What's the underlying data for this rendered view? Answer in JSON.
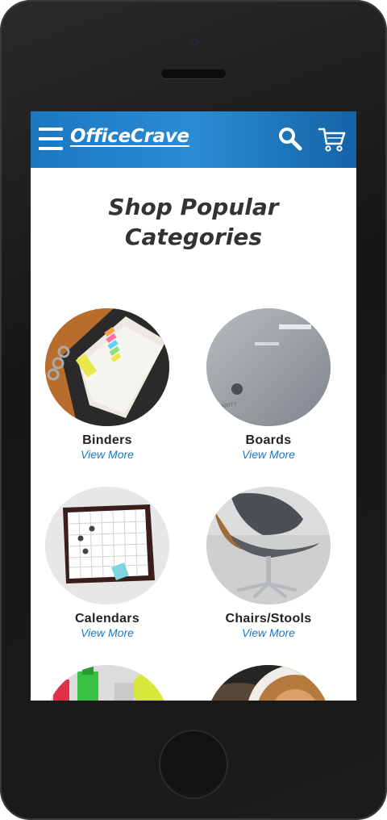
{
  "app": {
    "brand": "OfficeCrave"
  },
  "header": {
    "menu_icon": "hamburger-icon",
    "search_icon": "search-icon",
    "cart_icon": "cart-icon"
  },
  "main": {
    "title_line1": "Shop Popular",
    "title_line2": "Categories",
    "categories": [
      {
        "label": "Binders",
        "link": "View More"
      },
      {
        "label": "Boards",
        "link": "View More"
      },
      {
        "label": "Calendars",
        "link": "View More"
      },
      {
        "label": "Chairs/Stools",
        "link": "View More"
      },
      {
        "label": "",
        "link": ""
      },
      {
        "label": "",
        "link": ""
      }
    ]
  },
  "colors": {
    "header_blue": "#1a78c2",
    "link_blue": "#1a78c2",
    "title_text": "#333333",
    "device_body": "#1c1c1c"
  }
}
